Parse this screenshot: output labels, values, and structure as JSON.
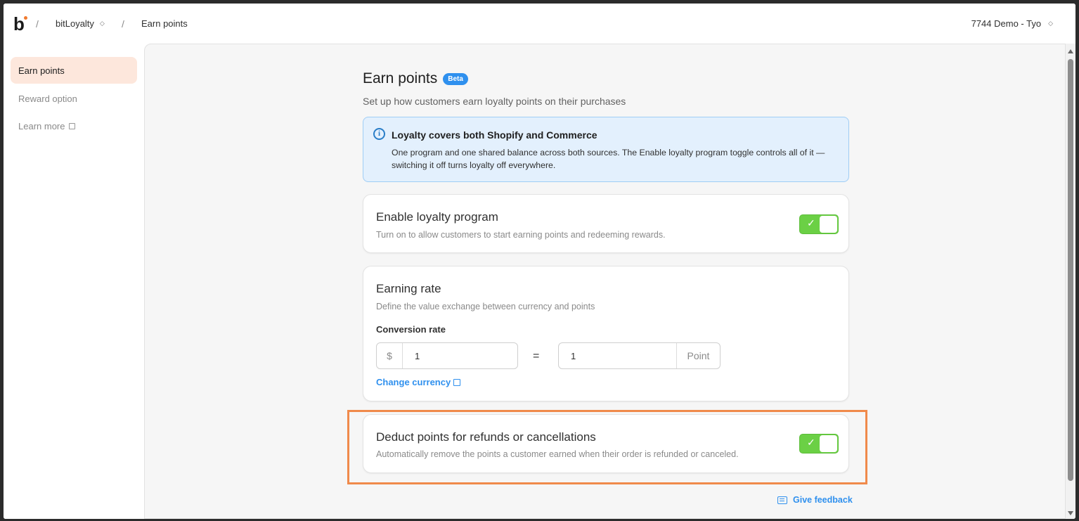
{
  "topbar": {
    "logo_text": "b",
    "separator": "/",
    "app_name": "bitLoyalty",
    "current_page": "Earn points",
    "store_name": "7744 Demo - Tyo",
    "updown_glyph": "◇"
  },
  "sidebar": {
    "items": [
      {
        "label": "Earn points"
      },
      {
        "label": "Reward option"
      },
      {
        "label": "Learn more"
      }
    ]
  },
  "page": {
    "title": "Earn points",
    "badge": "Beta",
    "subtitle": "Set up how customers earn loyalty points on their purchases"
  },
  "info_banner": {
    "icon": "i",
    "title": "Loyalty covers both Shopify and Commerce",
    "body": "One program and one shared balance across both sources. The Enable loyalty program toggle controls all of it — switching it off turns loyalty off everywhere."
  },
  "enable_card": {
    "title": "Enable loyalty program",
    "description": "Turn on to allow customers to start earning points and redeeming rewards.",
    "toggle_on": true,
    "check": "✓"
  },
  "rate_card": {
    "title": "Earning rate",
    "description": "Define the value exchange between currency and points",
    "conversion_label": "Conversion rate",
    "currency_prefix": "$",
    "currency_value": "1",
    "equals": "=",
    "points_value": "1",
    "points_suffix": "Point",
    "change_currency_link": "Change currency"
  },
  "deduct_card": {
    "title": "Deduct points for refunds or cancellations",
    "description": "Automatically remove the points a customer earned when their order is refunded or canceled.",
    "toggle_on": true,
    "check": "✓"
  },
  "feedback_link": "Give feedback",
  "colors": {
    "accent_blue": "#2f90ee",
    "toggle_green": "#6bd045",
    "highlight_orange": "#f08a4b",
    "nav_active_bg": "#fde7dc"
  }
}
